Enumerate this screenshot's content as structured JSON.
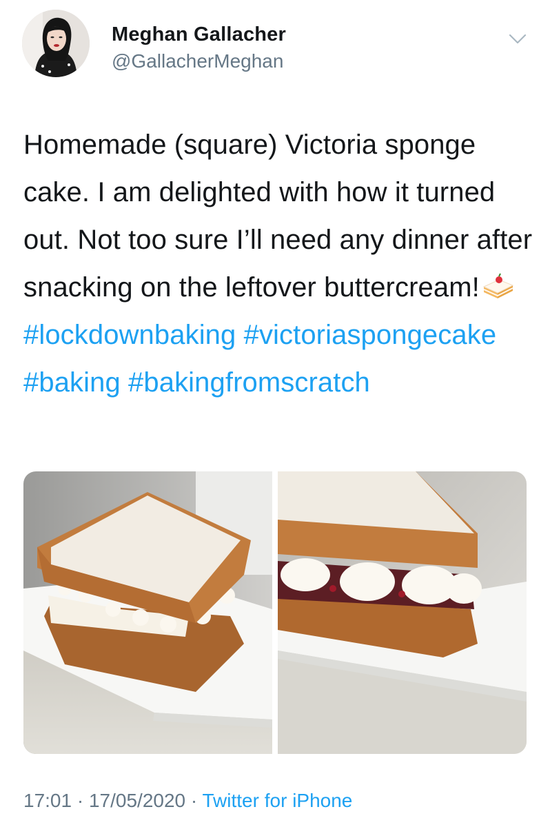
{
  "user": {
    "display_name": "Meghan Gallacher",
    "handle": "@GallacherMeghan"
  },
  "tweet": {
    "text_intro": "Homemade (square) Victoria sponge cake. I am delighted with how it turned out. Not too sure I’ll need any dinner after snacking on the leftover buttercream!",
    "emoji_icon": "shortcake-icon",
    "hashtags": [
      "#lockdownbaking",
      "#victoriaspongecake",
      "#baking",
      "#bakingfromscratch"
    ],
    "media_count": 2
  },
  "meta": {
    "time": "17:01",
    "separator": "·",
    "date": "17/05/2020",
    "source": "Twitter for iPhone"
  },
  "colors": {
    "link": "#1da1f2",
    "secondary_text": "#657786",
    "primary_text": "#14171a"
  }
}
